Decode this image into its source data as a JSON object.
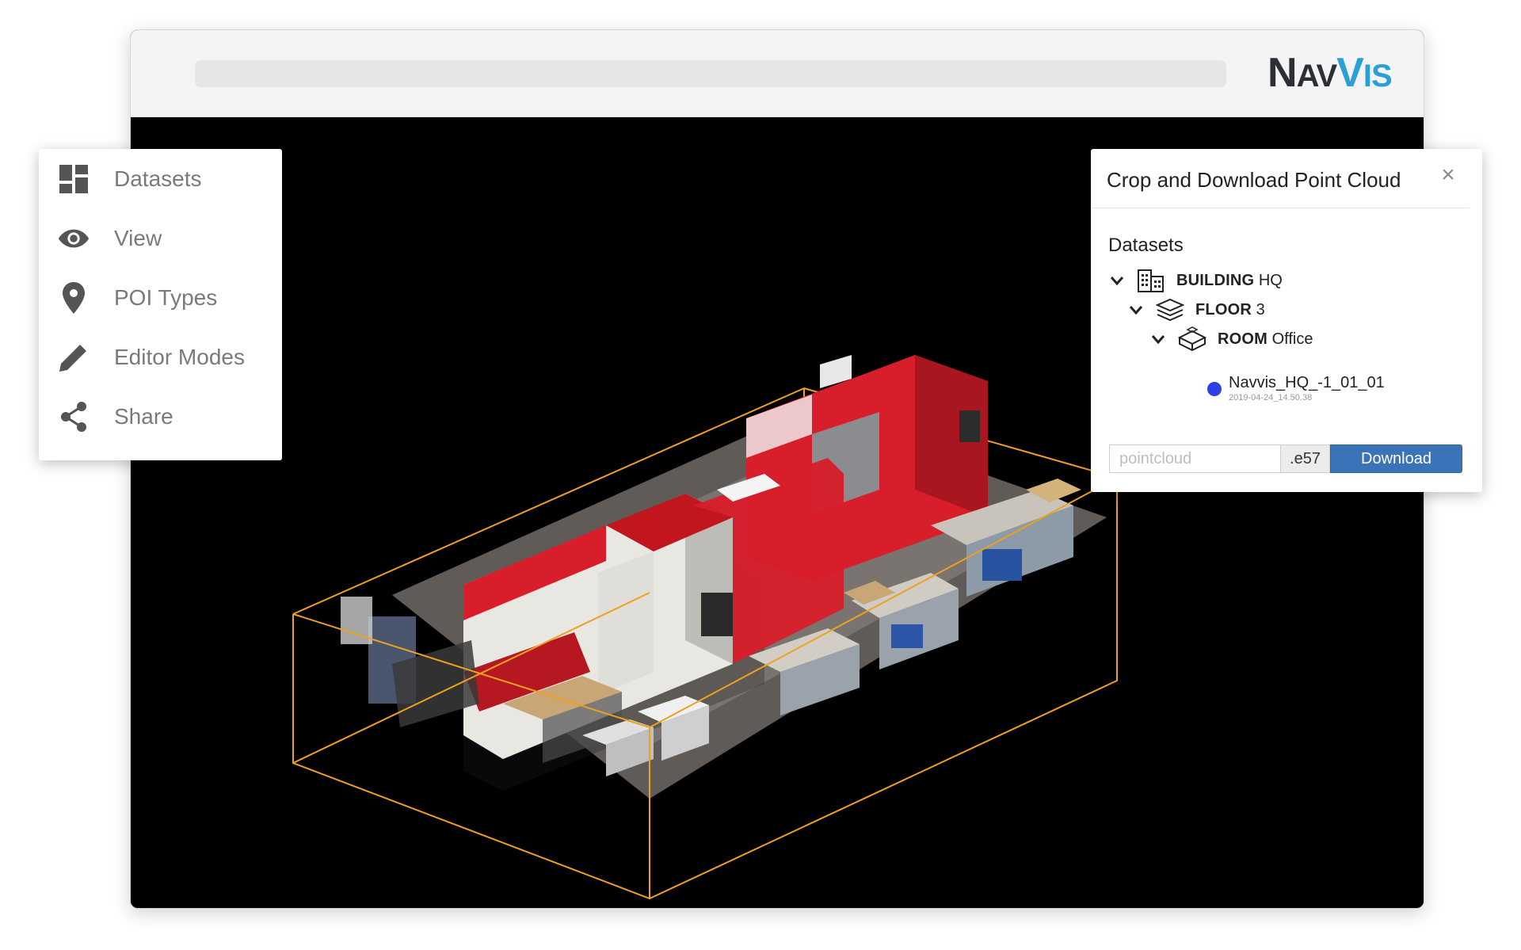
{
  "brand": {
    "part1": "Nav",
    "part2": "Vis"
  },
  "colors": {
    "brand_dark": "#2b2f36",
    "brand_blue": "#2a9fd8",
    "crop_box": "#f0a020",
    "machine_red": "#d81e2a",
    "button_blue": "#3b73b8",
    "dataset_dot": "#2f3fe6"
  },
  "side_menu": {
    "items": [
      {
        "label": "Datasets",
        "icon": "dashboard-icon"
      },
      {
        "label": "View",
        "icon": "eye-icon"
      },
      {
        "label": "POI Types",
        "icon": "map-pin-icon"
      },
      {
        "label": "Editor Modes",
        "icon": "pencil-icon"
      },
      {
        "label": "Share",
        "icon": "share-icon"
      }
    ]
  },
  "crop_panel": {
    "title": "Crop and Download Point Cloud",
    "close_glyph": "×",
    "section_label": "Datasets",
    "tree": {
      "building": {
        "kind": "BUILDING",
        "name": "HQ",
        "icon": "building-icon"
      },
      "floor": {
        "kind": "FLOOR",
        "name": "3",
        "icon": "layers-icon"
      },
      "room": {
        "kind": "ROOM",
        "name": "Office",
        "icon": "room-icon"
      },
      "dataset": {
        "name": "Navvis_HQ_-1_01_01",
        "date": "2019-04-24_14.50.38"
      }
    },
    "filename_placeholder": "pointcloud",
    "extension": ".e57",
    "download_label": "Download"
  }
}
